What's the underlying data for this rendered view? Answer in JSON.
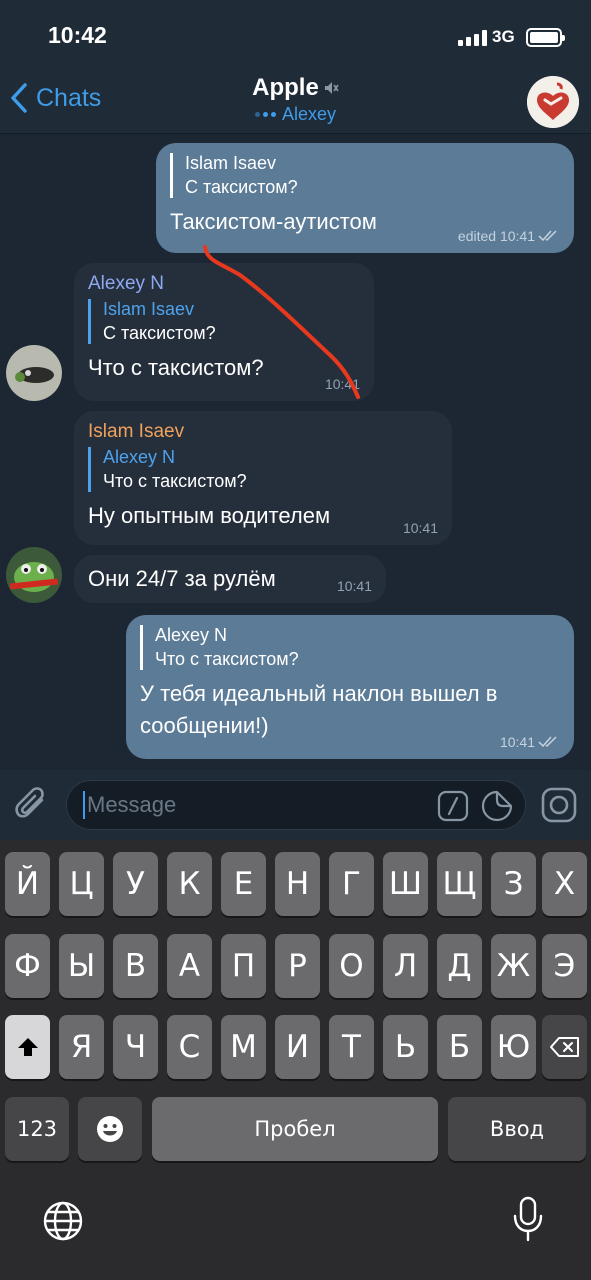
{
  "status": {
    "time": "10:42",
    "network": "3G"
  },
  "header": {
    "back_label": "Chats",
    "title": "Apple",
    "subtitle": "Alexey"
  },
  "messages": [
    {
      "sender": "",
      "reply_name": "Islam Isaev",
      "reply_text": "С таксистом?",
      "text": "Таксистом-аутистом",
      "meta": "edited 10:41"
    },
    {
      "sender": "Alexey N",
      "reply_name": "Islam Isaev",
      "reply_text": "С таксистом?",
      "text": "Что с таксистом?",
      "meta": "10:41"
    },
    {
      "sender": "Islam Isaev",
      "reply_name": "Alexey N",
      "reply_text": "Что с таксистом?",
      "text": "Ну опытным водителем",
      "meta": "10:41"
    },
    {
      "sender": "",
      "text": "Они 24/7 за рулём",
      "meta": "10:41"
    },
    {
      "sender": "",
      "reply_name": "Alexey N",
      "reply_text": "Что с таксистом?",
      "text": "У тебя идеальный наклон вышел в сообщении!)",
      "meta": "10:41"
    }
  ],
  "colors": {
    "sender_alexey": "#8ea8f2",
    "sender_islam": "#f0a25c",
    "accent": "#3e9ce8",
    "annotation": "#e8391f"
  },
  "input": {
    "placeholder": "Message"
  },
  "keyboard": {
    "row1": [
      "Й",
      "Ц",
      "У",
      "К",
      "Е",
      "Н",
      "Г",
      "Ш",
      "Щ",
      "З",
      "Х"
    ],
    "row2": [
      "Ф",
      "Ы",
      "В",
      "А",
      "П",
      "Р",
      "О",
      "Л",
      "Д",
      "Ж",
      "Э"
    ],
    "row3": [
      "Я",
      "Ч",
      "С",
      "М",
      "И",
      "Т",
      "Ь",
      "Б",
      "Ю"
    ],
    "numbers_label": "123",
    "space_label": "Пробел",
    "return_label": "Ввод"
  }
}
